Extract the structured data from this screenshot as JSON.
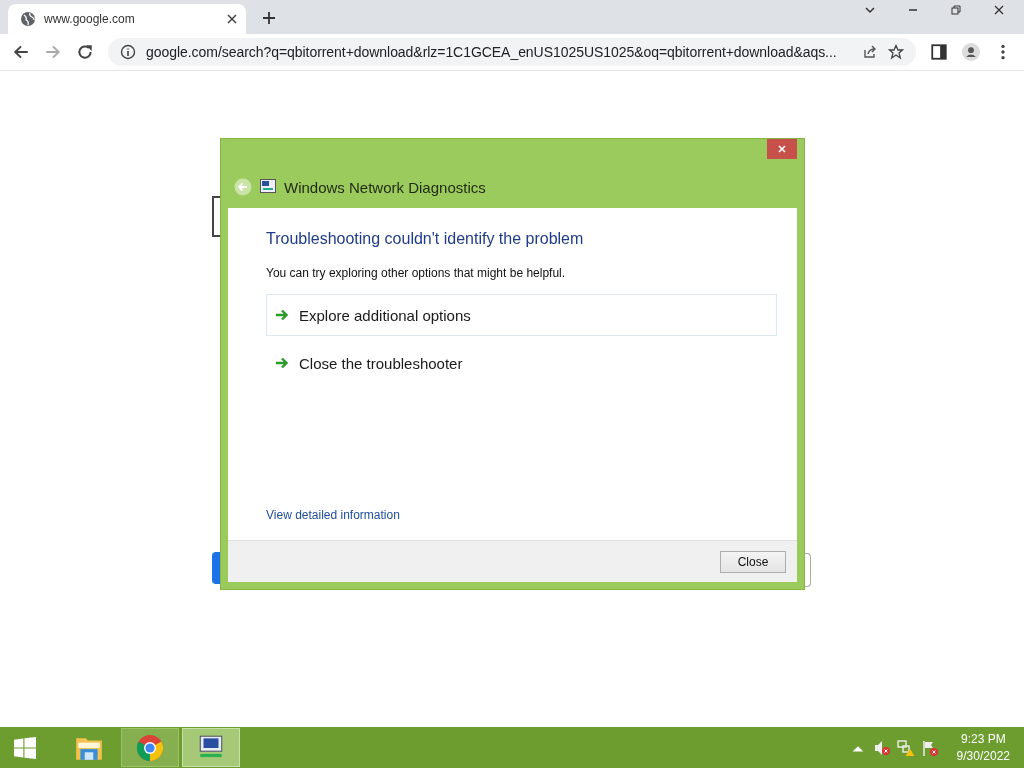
{
  "browser": {
    "tab": {
      "title": "www.google.com"
    },
    "url": "google.com/search?q=qbitorrent+download&rlz=1C1GCEA_enUS1025US1025&oq=qbitorrent+download&aqs..."
  },
  "dialog": {
    "title": "Windows Network Diagnostics",
    "heading": "Troubleshooting couldn't identify the problem",
    "message": "You can try exploring other options that might be helpful.",
    "options": [
      {
        "label": "Explore additional options",
        "selected": true
      },
      {
        "label": "Close the troubleshooter",
        "selected": false
      }
    ],
    "details_link": "View detailed information",
    "button": "Close"
  },
  "taskbar": {
    "apps": [
      {
        "kind": "explorer",
        "selected": false
      },
      {
        "kind": "chrome",
        "selected": false
      },
      {
        "kind": "network",
        "selected": true
      }
    ],
    "time": "9:23 PM",
    "date": "9/30/2022"
  }
}
